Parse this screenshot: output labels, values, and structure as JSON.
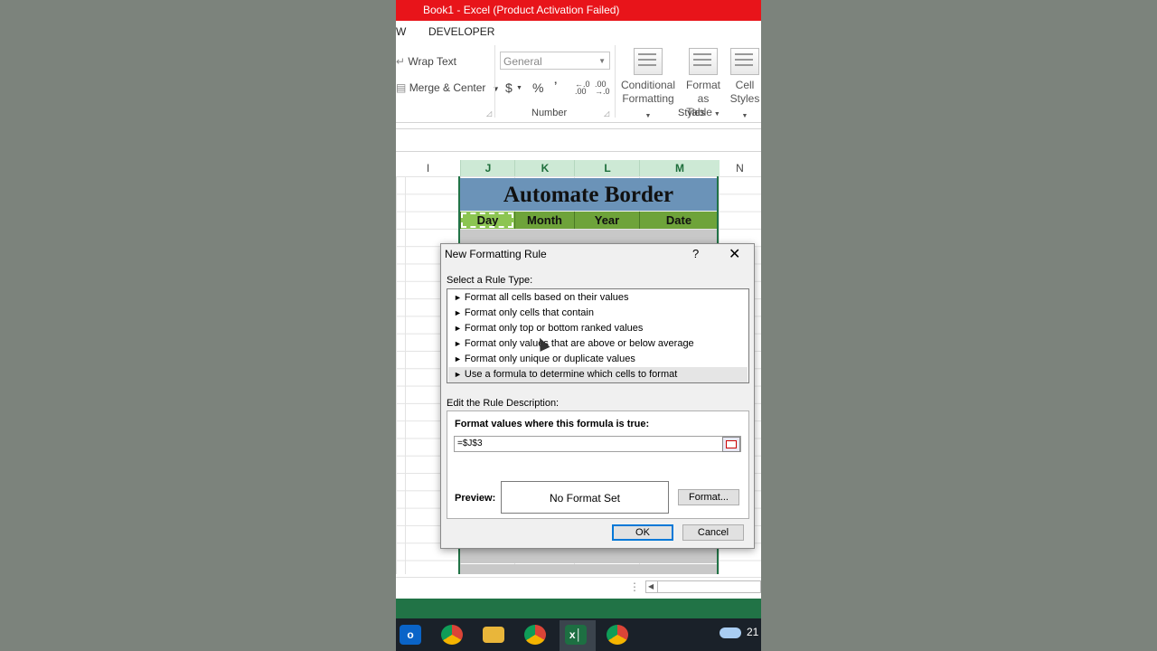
{
  "window": {
    "title": "Book1 -  Excel (Product Activation Failed)"
  },
  "tabs": {
    "partial": "W",
    "developer": "DEVELOPER"
  },
  "ribbon": {
    "wrap_text": "Wrap Text",
    "merge_center": "Merge & Center",
    "number_format": "General",
    "currency": "$",
    "percent": "%",
    "comma": "’",
    "inc_decimal": "←.0 .00",
    "dec_decimal": ".00 →.0",
    "number_group": "Number",
    "conditional_formatting": [
      "Conditional",
      "Formatting"
    ],
    "format_as_table": [
      "Format as",
      "Table"
    ],
    "cell_styles": [
      "Cell",
      "Styles"
    ],
    "styles_group": "Styles"
  },
  "sheet": {
    "columns": [
      "I",
      "J",
      "K",
      "L",
      "M",
      "N"
    ],
    "title": "Automate Border",
    "headers": [
      "Day",
      "Month",
      "Year",
      "Date"
    ]
  },
  "dialog": {
    "title": "New Formatting Rule",
    "help": "?",
    "close": "✕",
    "select_rule_label": "Select a Rule Type:",
    "rules": [
      "Format all cells based on their values",
      "Format only cells that contain",
      "Format only top or bottom ranked values",
      "Format only values that are above or below average",
      "Format only unique or duplicate values",
      "Use a formula to determine which cells to format"
    ],
    "selected_rule_index": 5,
    "edit_label": "Edit the Rule Description:",
    "formula_label": "Format values where this formula is true:",
    "formula_value": "=$J$3",
    "preview_label": "Preview:",
    "preview_text": "No Format Set",
    "format_button": "Format...",
    "ok_button": "OK",
    "cancel_button": "Cancel"
  },
  "taskbar": {
    "excel": "x│",
    "time_partial": "21"
  }
}
